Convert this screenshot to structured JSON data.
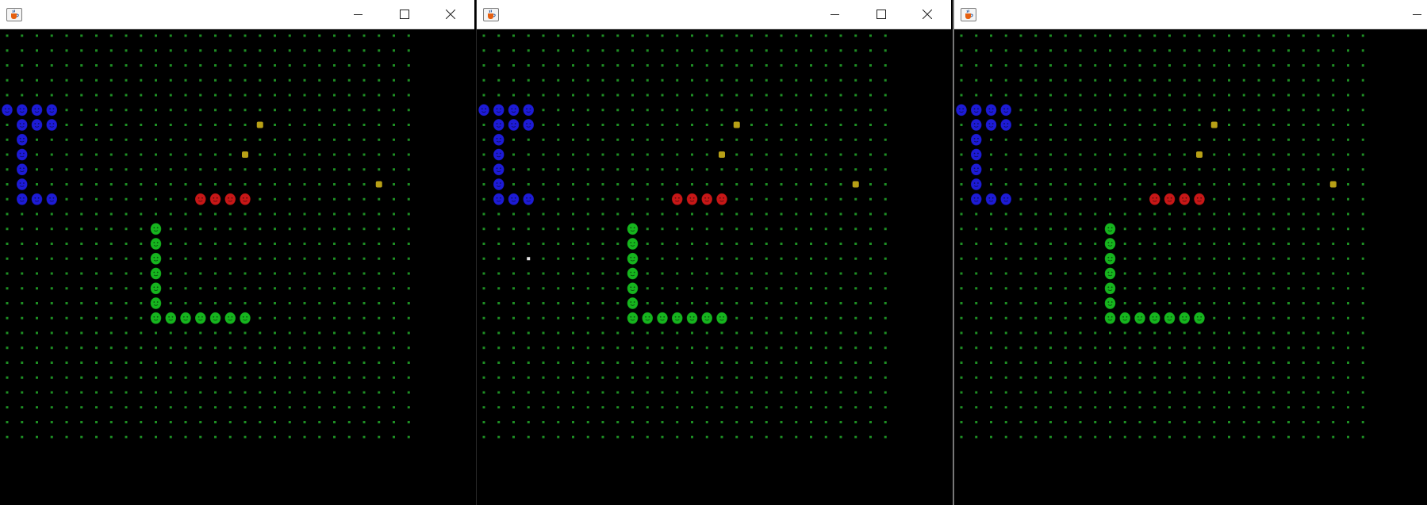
{
  "windows": [
    {
      "id": "win1",
      "app_icon": "java-cup-icon",
      "controls": [
        "minimize-icon",
        "maximize-icon",
        "close-icon"
      ],
      "snakes": [
        {
          "color": "#1d1bd6",
          "cells": [
            [
              0,
              5
            ],
            [
              1,
              5
            ],
            [
              2,
              5
            ],
            [
              3,
              5
            ],
            [
              1,
              6
            ],
            [
              2,
              6
            ],
            [
              3,
              6
            ],
            [
              1,
              7
            ],
            [
              1,
              8
            ],
            [
              1,
              9
            ],
            [
              1,
              10
            ],
            [
              1,
              11
            ],
            [
              2,
              11
            ],
            [
              3,
              11
            ]
          ]
        },
        {
          "color": "#c81717",
          "cells": [
            [
              13,
              11
            ],
            [
              14,
              11
            ],
            [
              15,
              11
            ],
            [
              16,
              11
            ]
          ]
        },
        {
          "color": "#16b51e",
          "cells": [
            [
              10,
              13
            ],
            [
              10,
              14
            ],
            [
              10,
              15
            ],
            [
              10,
              16
            ],
            [
              10,
              17
            ],
            [
              10,
              18
            ],
            [
              10,
              19
            ],
            [
              11,
              19
            ],
            [
              12,
              19
            ],
            [
              13,
              19
            ],
            [
              14,
              19
            ],
            [
              15,
              19
            ],
            [
              16,
              19
            ]
          ]
        }
      ],
      "food": [
        [
          17,
          6
        ],
        [
          16,
          8
        ],
        [
          25,
          10
        ]
      ],
      "white_dots": []
    },
    {
      "id": "win2",
      "app_icon": "java-cup-icon",
      "controls": [
        "minimize-icon",
        "maximize-icon",
        "close-icon"
      ],
      "snakes": [
        {
          "color": "#1d1bd6",
          "cells": [
            [
              0,
              5
            ],
            [
              1,
              5
            ],
            [
              2,
              5
            ],
            [
              3,
              5
            ],
            [
              1,
              6
            ],
            [
              2,
              6
            ],
            [
              3,
              6
            ],
            [
              1,
              7
            ],
            [
              1,
              8
            ],
            [
              1,
              9
            ],
            [
              1,
              10
            ],
            [
              1,
              11
            ],
            [
              2,
              11
            ],
            [
              3,
              11
            ]
          ]
        },
        {
          "color": "#c81717",
          "cells": [
            [
              13,
              11
            ],
            [
              14,
              11
            ],
            [
              15,
              11
            ],
            [
              16,
              11
            ]
          ]
        },
        {
          "color": "#16b51e",
          "cells": [
            [
              10,
              13
            ],
            [
              10,
              14
            ],
            [
              10,
              15
            ],
            [
              10,
              16
            ],
            [
              10,
              17
            ],
            [
              10,
              18
            ],
            [
              10,
              19
            ],
            [
              11,
              19
            ],
            [
              12,
              19
            ],
            [
              13,
              19
            ],
            [
              14,
              19
            ],
            [
              15,
              19
            ],
            [
              16,
              19
            ]
          ]
        }
      ],
      "food": [
        [
          17,
          6
        ],
        [
          16,
          8
        ],
        [
          25,
          10
        ]
      ],
      "white_dots": [
        [
          3,
          15
        ]
      ]
    },
    {
      "id": "win3",
      "app_icon": "java-cup-icon",
      "controls": [
        "minimize-icon"
      ],
      "snakes": [
        {
          "color": "#1d1bd6",
          "cells": [
            [
              0,
              5
            ],
            [
              1,
              5
            ],
            [
              2,
              5
            ],
            [
              3,
              5
            ],
            [
              1,
              6
            ],
            [
              2,
              6
            ],
            [
              3,
              6
            ],
            [
              1,
              7
            ],
            [
              1,
              8
            ],
            [
              1,
              9
            ],
            [
              1,
              10
            ],
            [
              1,
              11
            ],
            [
              2,
              11
            ],
            [
              3,
              11
            ]
          ]
        },
        {
          "color": "#c81717",
          "cells": [
            [
              13,
              11
            ],
            [
              14,
              11
            ],
            [
              15,
              11
            ],
            [
              16,
              11
            ]
          ]
        },
        {
          "color": "#16b51e",
          "cells": [
            [
              10,
              13
            ],
            [
              10,
              14
            ],
            [
              10,
              15
            ],
            [
              10,
              16
            ],
            [
              10,
              17
            ],
            [
              10,
              18
            ],
            [
              10,
              19
            ],
            [
              11,
              19
            ],
            [
              12,
              19
            ],
            [
              13,
              19
            ],
            [
              14,
              19
            ],
            [
              15,
              19
            ],
            [
              16,
              19
            ]
          ]
        }
      ],
      "food": [
        [
          17,
          6
        ],
        [
          16,
          8
        ],
        [
          25,
          10
        ]
      ],
      "white_dots": []
    }
  ]
}
